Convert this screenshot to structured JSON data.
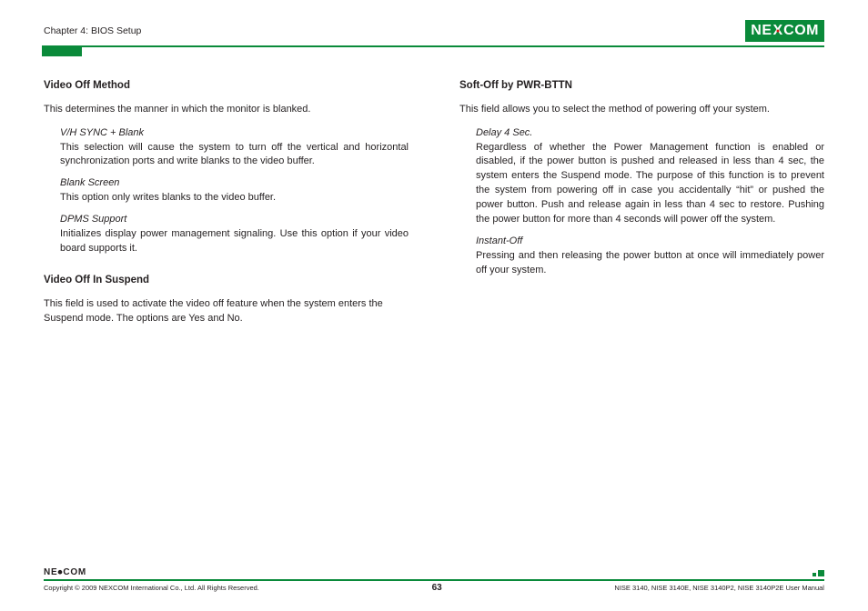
{
  "header": {
    "chapter": "Chapter 4: BIOS Setup",
    "logo_pre": "NE",
    "logo_x": "X",
    "logo_post": "COM"
  },
  "left_col": {
    "sec1": {
      "heading": "Video Off Method",
      "intro": "This determines the manner in which the monitor is blanked.",
      "items": [
        {
          "label": "V/H SYNC + Blank",
          "desc": "This selection will cause the system to turn off the vertical and horizontal synchronization ports and write blanks to the video buffer."
        },
        {
          "label": "Blank Screen",
          "desc": "This option only writes blanks to the video buffer."
        },
        {
          "label": "DPMS Support",
          "desc": "Initializes display power management signaling. Use this option if your video board supports it."
        }
      ]
    },
    "sec2": {
      "heading": "Video Off In Suspend",
      "intro": "This field is used to activate the video off feature when the system enters the Suspend mode. The options are Yes and No."
    }
  },
  "right_col": {
    "sec1": {
      "heading": "Soft-Off by PWR-BTTN",
      "intro": "This field allows you to select the method of powering off your system.",
      "items": [
        {
          "label": "Delay 4 Sec.",
          "desc": "Regardless of whether the Power Management function is enabled or disabled, if the power button is pushed and released in less than 4 sec, the system enters the Suspend mode. The purpose of this function is to prevent the system from powering off in case you accidentally “hit” or pushed the power button. Push and release again in less than 4 sec to restore. Pushing the power button for more than 4 seconds will power off the system."
        },
        {
          "label": "Instant-Off",
          "desc": "Pressing and then releasing the power button at once will immediately power off your system."
        }
      ]
    }
  },
  "footer": {
    "logo": "NE·COM",
    "copyright": "Copyright © 2009 NEXCOM International Co., Ltd. All Rights Reserved.",
    "page": "63",
    "manual": "NISE 3140, NISE 3140E, NISE 3140P2, NISE 3140P2E User Manual"
  }
}
